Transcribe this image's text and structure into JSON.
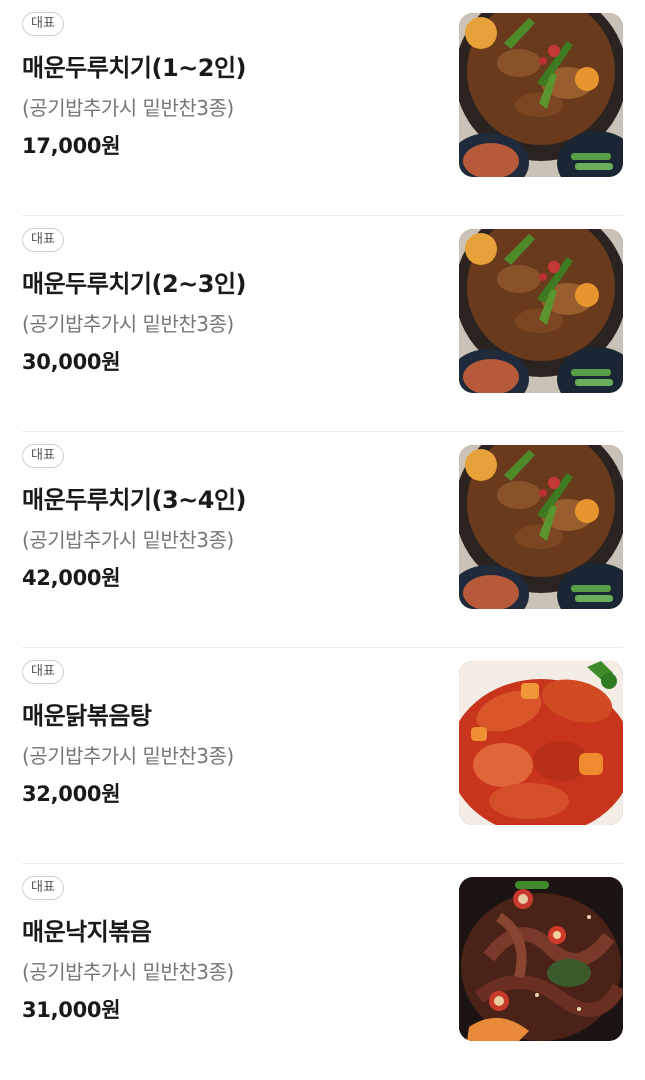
{
  "menu": {
    "items": [
      {
        "badge": "대표",
        "name": "매운두루치기(1~2인)",
        "desc": "(공기밥추가시 밑반찬3종)",
        "price": "17,000원",
        "image": "duruchigi"
      },
      {
        "badge": "대표",
        "name": "매운두루치기(2~3인)",
        "desc": "(공기밥추가시 밑반찬3종)",
        "price": "30,000원",
        "image": "duruchigi"
      },
      {
        "badge": "대표",
        "name": "매운두루치기(3~4인)",
        "desc": "(공기밥추가시 밑반찬3종)",
        "price": "42,000원",
        "image": "duruchigi"
      },
      {
        "badge": "대표",
        "name": "매운닭볶음탕",
        "desc": "(공기밥추가시 밑반찬3종)",
        "price": "32,000원",
        "image": "dakbokkeumtang"
      },
      {
        "badge": "대표",
        "name": "매운낙지볶음",
        "desc": "(공기밥추가시 밑반찬3종)",
        "price": "31,000원",
        "image": "nakji"
      }
    ]
  }
}
